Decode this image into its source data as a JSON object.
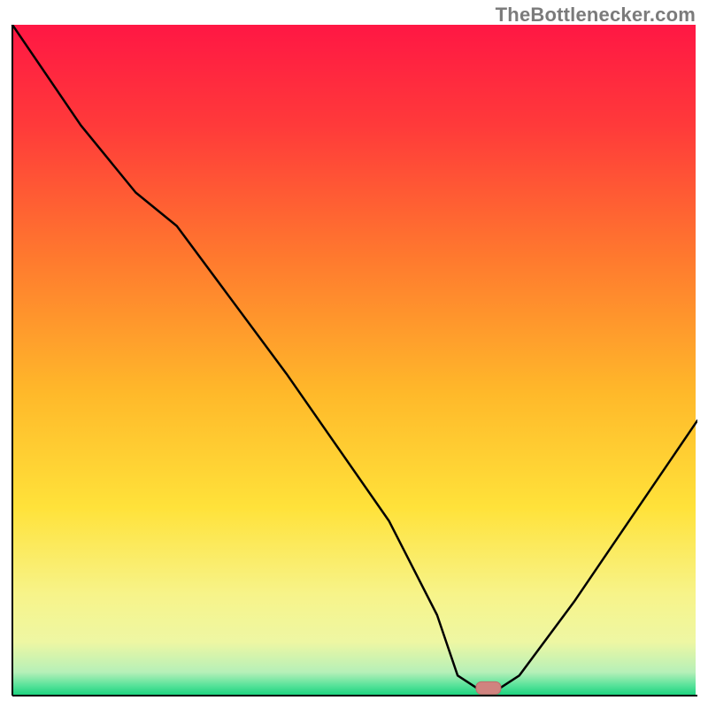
{
  "attribution": "TheBottlenecker.com",
  "chart_data": {
    "type": "line",
    "title": "",
    "xlabel": "",
    "ylabel": "",
    "xlim": [
      0,
      100
    ],
    "ylim": [
      0,
      100
    ],
    "background_gradient": {
      "stops": [
        {
          "offset": 0.0,
          "color": "#ff1744"
        },
        {
          "offset": 0.15,
          "color": "#ff3a3a"
        },
        {
          "offset": 0.35,
          "color": "#ff7a2e"
        },
        {
          "offset": 0.55,
          "color": "#ffb92a"
        },
        {
          "offset": 0.72,
          "color": "#ffe23a"
        },
        {
          "offset": 0.85,
          "color": "#f7f48a"
        },
        {
          "offset": 0.92,
          "color": "#eef7a3"
        },
        {
          "offset": 0.965,
          "color": "#b6f0b8"
        },
        {
          "offset": 0.985,
          "color": "#57e29a"
        },
        {
          "offset": 1.0,
          "color": "#19d27c"
        }
      ]
    },
    "series": [
      {
        "name": "bottleneck-curve",
        "x": [
          0,
          10,
          18,
          24,
          40,
          55,
          62,
          65,
          68,
          71,
          74,
          82,
          90,
          100
        ],
        "y": [
          100,
          85,
          75,
          70,
          48,
          26,
          12,
          3,
          1,
          1,
          3,
          14,
          26,
          41
        ]
      }
    ],
    "marker": {
      "x": 69.5,
      "y": 1,
      "color": "#d0837f"
    }
  }
}
